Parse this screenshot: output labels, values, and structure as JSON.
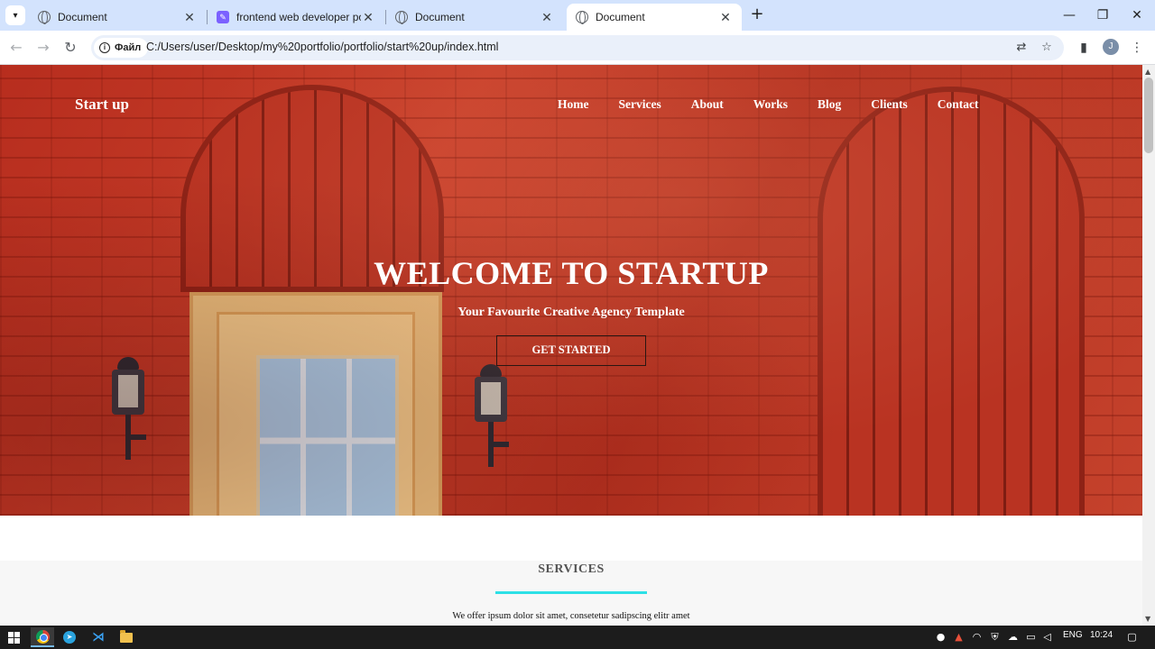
{
  "browser": {
    "tabs": [
      {
        "title": "Document",
        "active": false,
        "icon": "globe-icon"
      },
      {
        "title": "frontend web developer portfo",
        "active": false,
        "icon": "pen-icon"
      },
      {
        "title": "Document",
        "active": false,
        "icon": "globe-icon"
      },
      {
        "title": "Document",
        "active": true,
        "icon": "globe-icon"
      }
    ],
    "site_chip": "Файл",
    "url": "C:/Users/user/Desktop/my%20portfolio/portfolio/start%20up/index.html",
    "avatar_letter": "J"
  },
  "page": {
    "brand": "Start up",
    "nav": [
      "Home",
      "Services",
      "About",
      "Works",
      "Blog",
      "Clients",
      "Contact"
    ],
    "hero_title": "WELCOME TO STARTUP",
    "hero_subtitle": "Your Favourite Creative Agency Template",
    "hero_button": "GET STARTED",
    "services_title": "SERVICES",
    "services_text": "We offer ipsum dolor sit amet, consetetur sadipscing elitr amet",
    "accent_color": "#2de0e6"
  },
  "taskbar": {
    "language": "ENG",
    "time": "10:24"
  }
}
